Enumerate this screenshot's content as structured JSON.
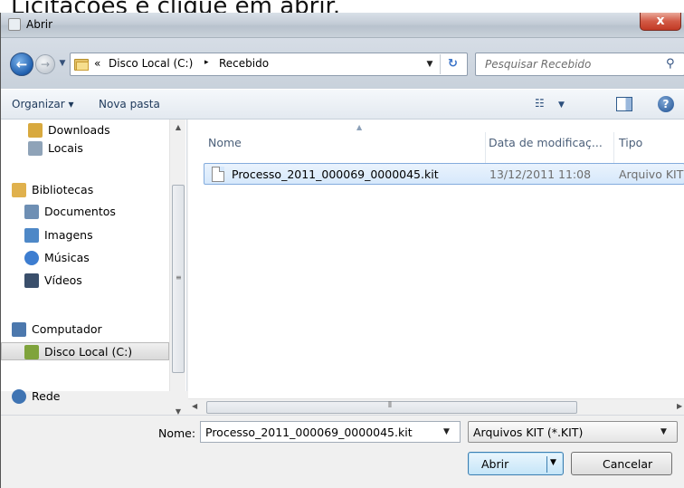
{
  "background_caption": "Licitações e clique em abrir.",
  "window": {
    "title": "Abrir",
    "close_glyph": "x"
  },
  "address": {
    "overflow": "«",
    "crumbs": [
      "Disco Local (C:)",
      "Recebido"
    ],
    "separator": "▸"
  },
  "search": {
    "placeholder": "Pesquisar Recebido"
  },
  "toolbar": {
    "organize": "Organizar ▾",
    "new_folder": "Nova pasta",
    "help": "?"
  },
  "nav": {
    "items": [
      {
        "label": "Downloads",
        "icon": "downloads-icon",
        "color": "#d8a93e"
      },
      {
        "label": "Locais",
        "icon": "places-icon",
        "color": "#8fa3b8"
      },
      {
        "label": "Bibliotecas",
        "icon": "libraries-icon",
        "color": "#e0b14d"
      },
      {
        "label": "Documentos",
        "icon": "documents-icon",
        "color": "#6e8fb4"
      },
      {
        "label": "Imagens",
        "icon": "images-icon",
        "color": "#4e88c7"
      },
      {
        "label": "Músicas",
        "icon": "music-icon",
        "color": "#3d7dd0"
      },
      {
        "label": "Vídeos",
        "icon": "videos-icon",
        "color": "#3a4f6b"
      },
      {
        "label": "Computador",
        "icon": "computer-icon",
        "color": "#4c78ad"
      },
      {
        "label": "Disco Local (C:)",
        "icon": "local-disk-icon",
        "color": "#7fa33c",
        "selected": true
      },
      {
        "label": "Rede",
        "icon": "network-icon",
        "color": "#3f74b3"
      }
    ]
  },
  "columns": {
    "name": "Nome",
    "modified": "Data de modificaç...",
    "type": "Tipo"
  },
  "files": [
    {
      "name": "Processo_2011_000069_0000045.kit",
      "modified": "13/12/2011 11:08",
      "type": "Arquivo KIT"
    }
  ],
  "bottom": {
    "filename_label": "Nome:",
    "filename_value": "Processo_2011_000069_0000045.kit",
    "filetype_value": "Arquivos KIT (*.KIT)",
    "open_label": "Abrir",
    "cancel_label": "Cancelar"
  },
  "colors": {
    "selection_border": "#84acdd",
    "selection_fill": "#d6e8fb",
    "close_button": "#d25a45",
    "toolbar_text": "#1e395b"
  }
}
